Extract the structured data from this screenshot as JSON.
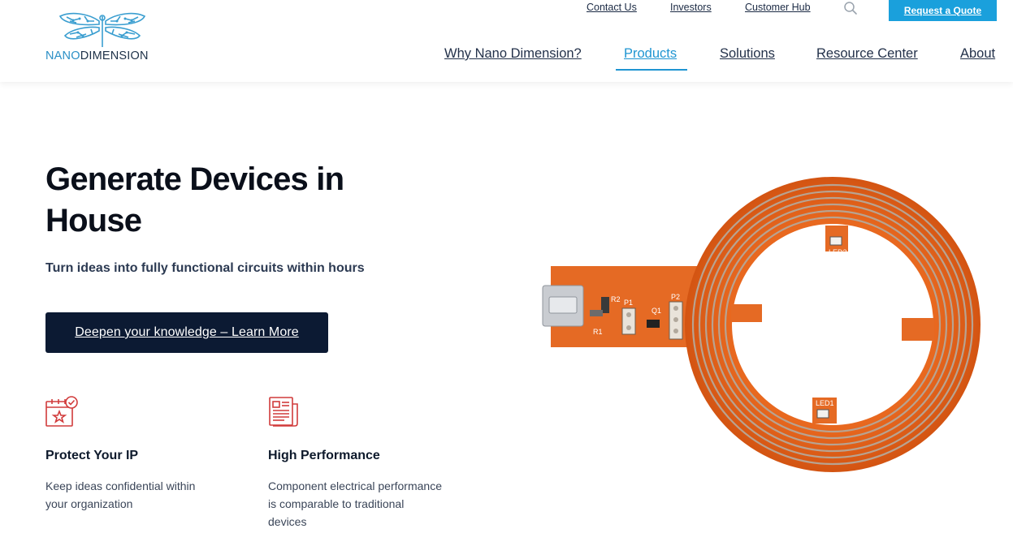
{
  "brand": {
    "logo_text_part1": "NANO",
    "logo_text_part2": "DIMENSION",
    "colors": {
      "accent": "#1aa0dc",
      "dark": "#0c1a33",
      "icon_red": "#d13b3b",
      "circuit_orange": "#e8681f"
    }
  },
  "utility_nav": {
    "contact": "Contact Us",
    "investors": "Investors",
    "customer_hub": "Customer Hub",
    "search_icon": "search-icon",
    "quote": "Request a Quote"
  },
  "main_nav": {
    "items": [
      {
        "label": "Why Nano Dimension?"
      },
      {
        "label": "Products",
        "active": true
      },
      {
        "label": "Solutions"
      },
      {
        "label": "Resource Center"
      },
      {
        "label": "About"
      }
    ]
  },
  "hero": {
    "title": "Generate Devices in House",
    "subtitle": "Turn ideas into fully functional circuits within hours",
    "cta": "Deepen your knowledge – Learn More"
  },
  "features": [
    {
      "icon": "calendar-star-check-icon",
      "title": "Protect Your IP",
      "text": "Keep ideas confidential within your organization"
    },
    {
      "icon": "document-newspaper-icon",
      "title": "High Performance",
      "text": "Component electrical performance is comparable to traditional devices"
    }
  ],
  "device_labels": {
    "r2": "R2",
    "p1": "P1",
    "q1": "Q1",
    "p2": "P2",
    "r1": "R1",
    "led2": "LED2",
    "led1": "LED1"
  }
}
